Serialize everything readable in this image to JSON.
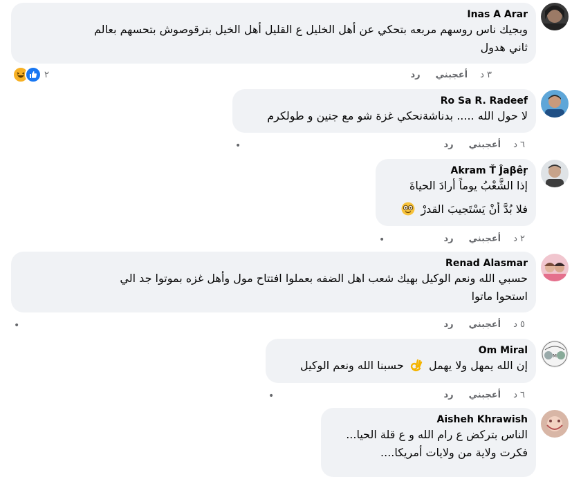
{
  "comments": [
    {
      "author": "Inas A Arar",
      "lines": [
        "وبجيك ناس روسهم مربعه بتحكي عن أهل الخليل ع القليل أهل الخيل بترقوصوش بتحسهم بعالم",
        "ثاني هدول"
      ],
      "time": "٣ د",
      "like": "أعجبني",
      "reply": "رد",
      "reactions": {
        "icons": [
          "haha",
          "like"
        ],
        "count": "٢"
      }
    },
    {
      "author": "Ro Sa R. Radeef",
      "lines": [
        "لا حول الله ..... بدناشةنحكي غزة شو مع جنين و طولكرم"
      ],
      "time": "٦ د",
      "like": "أعجبني",
      "reply": "رد"
    },
    {
      "author": "Akram Ť Ĵaβêŗ",
      "lines": [
        "إذا الشَّعْبُ يوماً أرادَ الحياةَ",
        "فلا بُدَّ أنْ يَسْتَجيبَ القدرْ"
      ],
      "time": "٢ د",
      "like": "أعجبني",
      "reply": "رد",
      "emoji": "nerd-face"
    },
    {
      "author": "Renad Alasmar",
      "lines": [
        "حسبي الله ونعم الوكيل بهيك شعب اهل الضفه بعملوا افتتاح مول وأهل غزه بموتوا جد الي",
        "استحوا ماتوا"
      ],
      "time": "٥ د",
      "like": "أعجبني",
      "reply": "رد"
    },
    {
      "author": "Om Miral",
      "lines": [
        "إن الله يمهل ولا يهمل",
        "حسبنا الله ونعم الوكيل"
      ],
      "time": "٦ د",
      "like": "أعجبني",
      "reply": "رد",
      "emoji": "ok-hand"
    },
    {
      "author": "Aisheh Khrawish",
      "lines": [
        "الناس بتركض ع رام الله و ع قلة الحيا...",
        "فكرت ولاية من ولايات أمريكا...."
      ]
    }
  ],
  "colors": {
    "bubble": "#f0f2f5",
    "text": "#050505",
    "meta": "#65676b",
    "like_blue": "#1877f2",
    "haha_yellow": "#f7b125"
  }
}
